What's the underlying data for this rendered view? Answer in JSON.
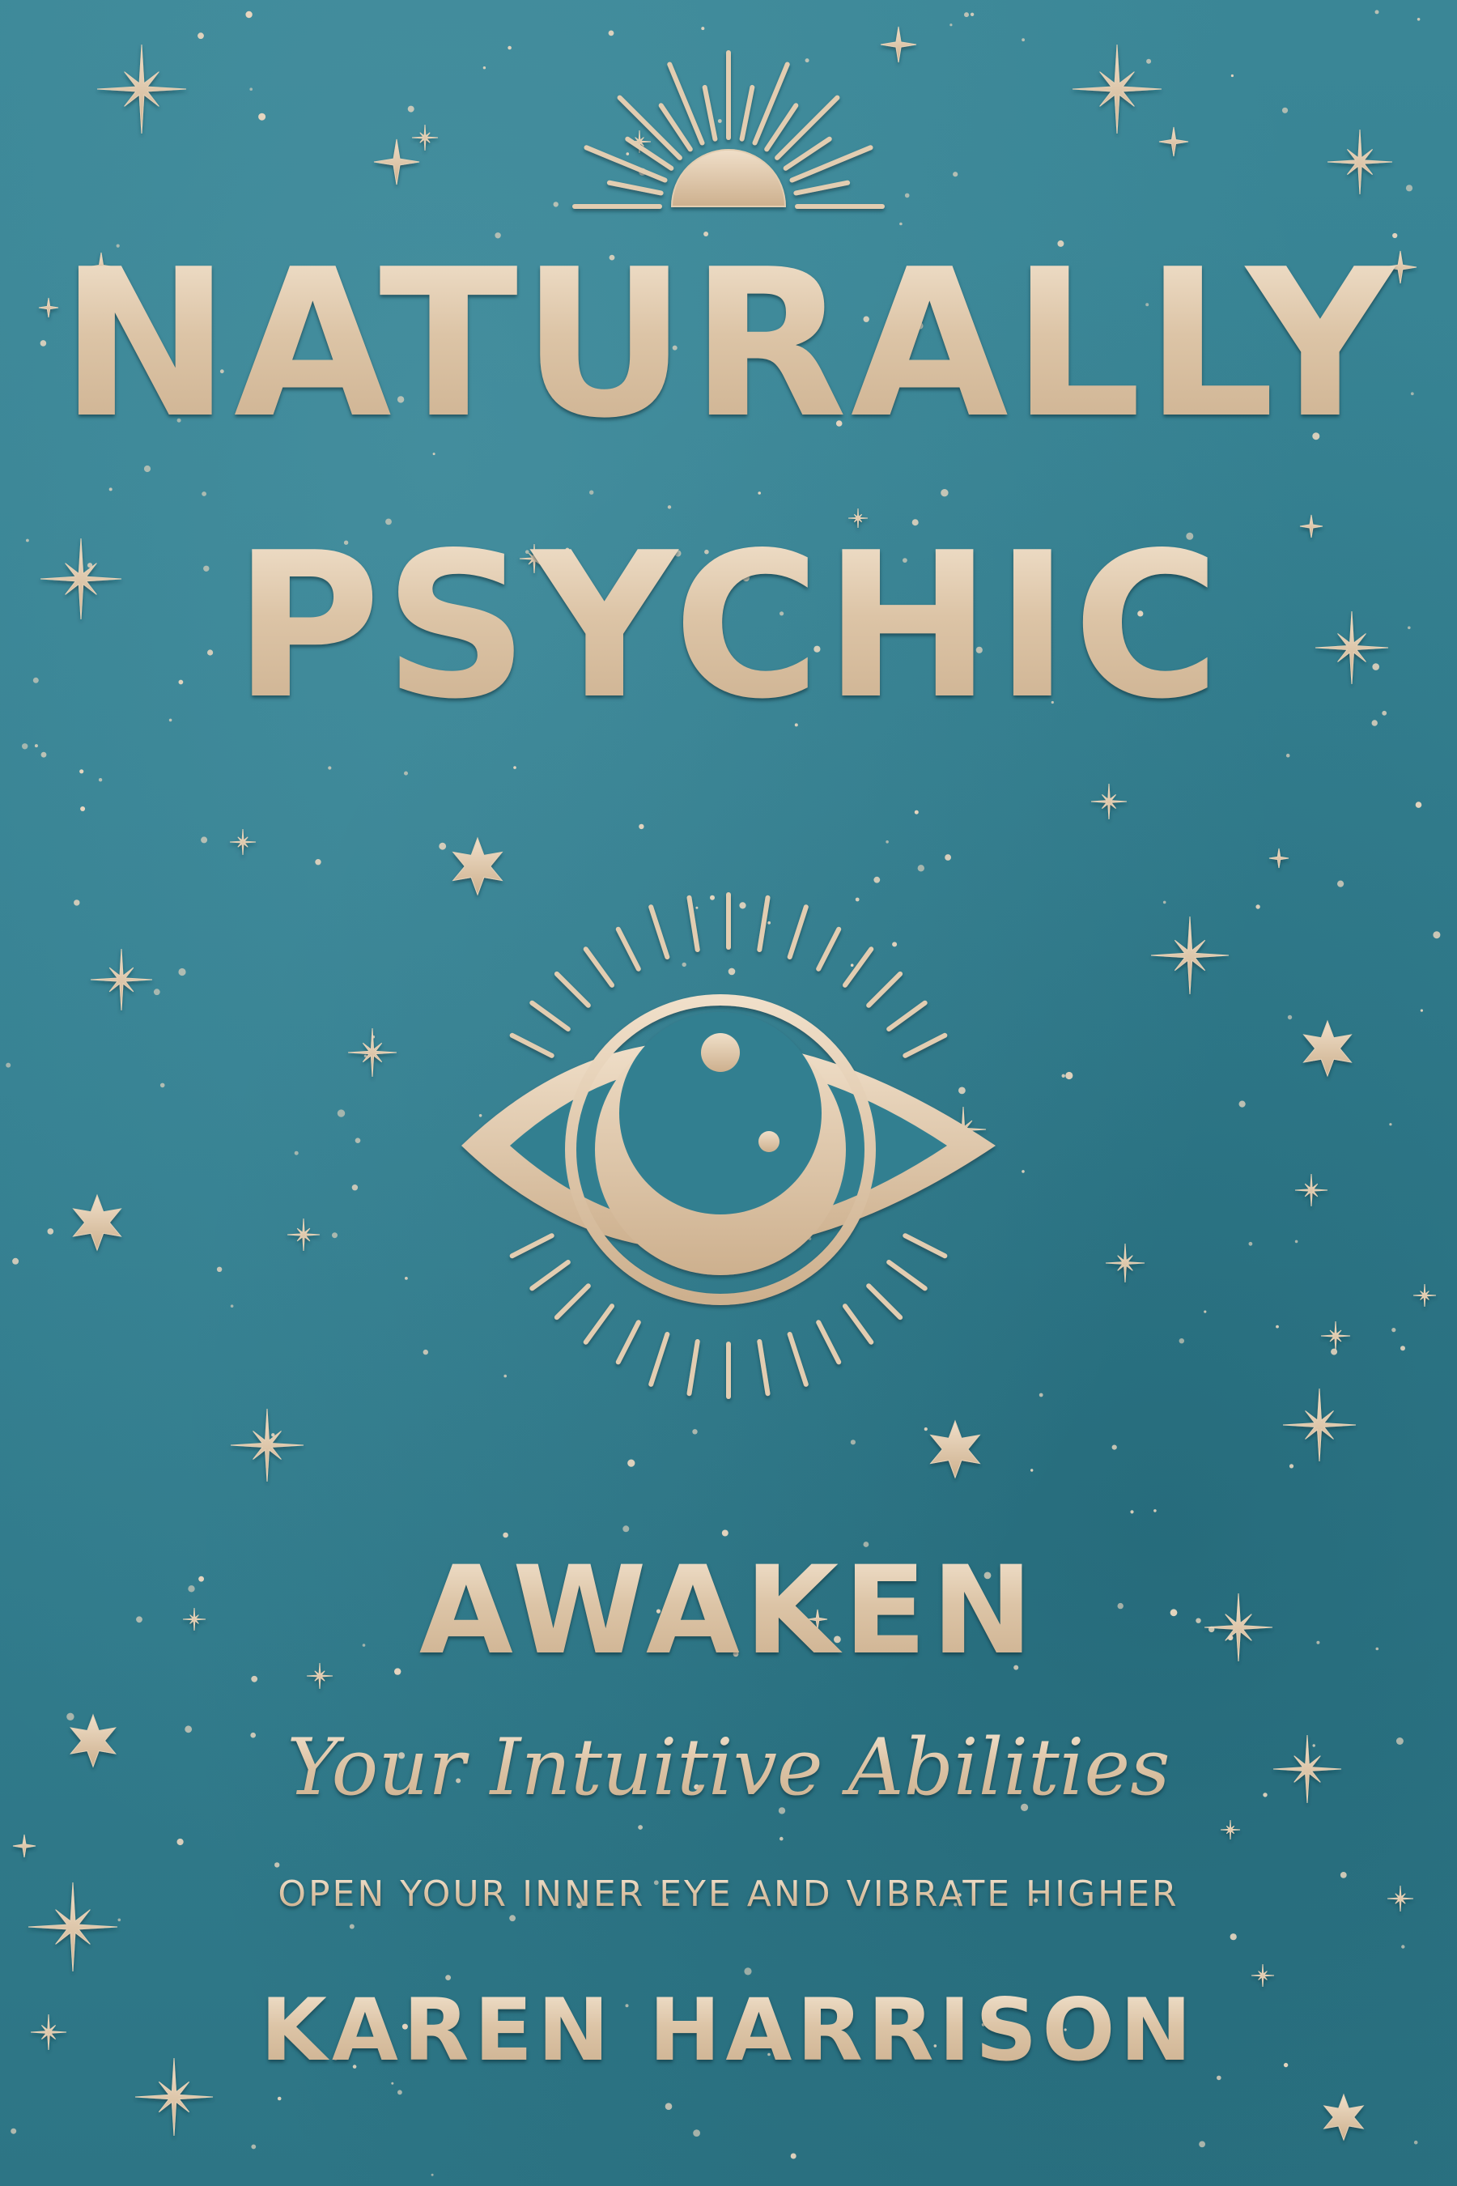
{
  "cover": {
    "title_line1": "NATURALLY",
    "title_line2": "PSYCHIC",
    "headline": "AWAKEN",
    "subtitle": "Your Intuitive Abilities",
    "tagline": "OPEN YOUR INNER EYE  AND  VIBRATE HIGHER",
    "author": "KAREN HARRISON"
  },
  "colors": {
    "background": "#337f90",
    "foil_gold": "#e3cdb2"
  },
  "icons": [
    "sunburst-icon",
    "eye-icon",
    "sparkle-star-icon",
    "six-point-star-icon"
  ]
}
